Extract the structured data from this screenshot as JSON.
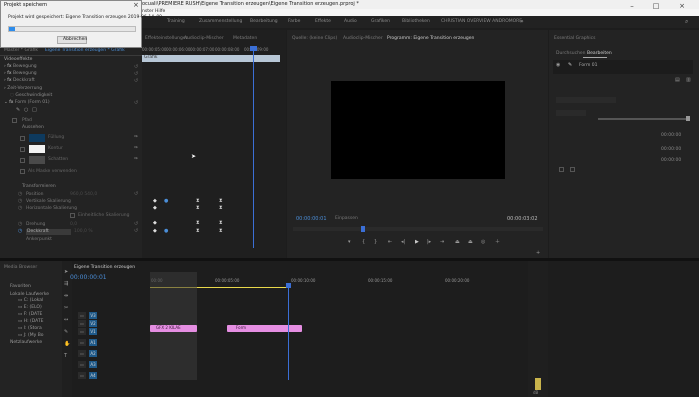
{
  "titlebar": {
    "title": "ocuali\\PREMIERE RUSH\\Eigene Transition erzeugen\\Eigene Transition erzeugen.prproj *",
    "menu_fenster": "nster",
    "menu_hilfe": "Hilfe"
  },
  "workspace_tabs": [
    "Training",
    "Zusammenstellung",
    "Bearbeitung",
    "Farbe",
    "Effekte",
    "Audio",
    "Grafiken",
    "Bibliotheken",
    "CHRISTIAN OVERVIEW ANDROMORE"
  ],
  "dialog": {
    "title": "Projekt speichern",
    "message": "Projekt wird gespeichert: Eigene Transition erzeugen 2019-06-14_09...",
    "cancel_label": "Abbrechen",
    "close_glyph": "×"
  },
  "effect_controls": {
    "tab_label": "Effekteinstellungen",
    "breadcrumb": "Master * Grafik",
    "clip_label": "Eigene Transition erzeugen * Grafik",
    "section_video": "Videoeffekte",
    "rows": [
      "Bewegung",
      "Bewegung",
      "Deckkraft",
      "Zeit-Verzerrung",
      "Geschwindigkeit",
      "Form (Form 01)"
    ],
    "appearance": "Aussehen",
    "fill_label": "Füllung",
    "stroke_label": "Kontur",
    "shadow_label": "Schatten",
    "mask_label": "Als Maske verwenden",
    "transform": "Transformieren",
    "position": "Position",
    "uniform_scale": "Vertikale Skalierung",
    "horiz_scale": "Horizontale Skalierung",
    "uniform_check": "Einheitliche Skalierung",
    "rotation": "Drehung",
    "opacity": "Deckkraft",
    "anchor": "Ankerpunkt",
    "position_value": "960,0   540,0",
    "opacity_value": "100,0 %",
    "rotation_value": "0,0"
  },
  "source_monitor": {
    "tabs": [
      "Effekteinstellungen",
      "Audioclip-Mischer",
      "Metadaten"
    ],
    "timecodes": [
      "00:00:05:00",
      "00:00:06:00",
      "00:00:07:00",
      "00:00:08:00",
      "00:00:09:00"
    ],
    "clip_bar_label": "Grafik"
  },
  "program_monitor": {
    "tabs": [
      "Quelle: (keine Clips)",
      "Audioclip-Mischer",
      "Programm: Eigene Transition erzeugen"
    ],
    "timecode_left": "00:00:00:01",
    "timecode_right": "00:00:03:02",
    "fit_label": "Einpassen"
  },
  "essential_graphics": {
    "tabs": [
      "Durchsuchen",
      "Bearbeiten"
    ],
    "title": "Essential Graphics",
    "layer_name": "Form 01",
    "timecodes": [
      "00:00:00",
      "00:00:00",
      "00:00:00"
    ]
  },
  "project_panel": {
    "tab_label": "Media Browser",
    "favorites": "Favoriten",
    "local_drives": "Lokale Laufwerke",
    "drives": [
      "C: (Lokal",
      "E: (ELO)",
      "F: (DATE",
      "H: (DATE",
      "I: (Stora",
      "J: (My Bo"
    ],
    "network": "Netzlaufwerke"
  },
  "timeline": {
    "tab_label": "Eigene Transition erzeugen",
    "timecode": "00:00:00:01",
    "ruler": [
      "00:00",
      "00:00:05:00",
      "00:00:10:00",
      "00:00:15:00",
      "00:00:20:00"
    ],
    "tracks_video": [
      "V3",
      "V2",
      "V1"
    ],
    "tracks_audio": [
      "A1",
      "A2",
      "A3",
      "A4"
    ],
    "clip1_label": "GFX 2 KILAE",
    "clip2_label": "Form",
    "level_meter_label": "dB"
  },
  "colors": {
    "accent_blue": "#2d8ceb",
    "clip_pink": "#e58ee2",
    "clip_graphic": "#a89ab0",
    "playhead": "#3b6fd6",
    "yellow": "#e8d84a"
  }
}
